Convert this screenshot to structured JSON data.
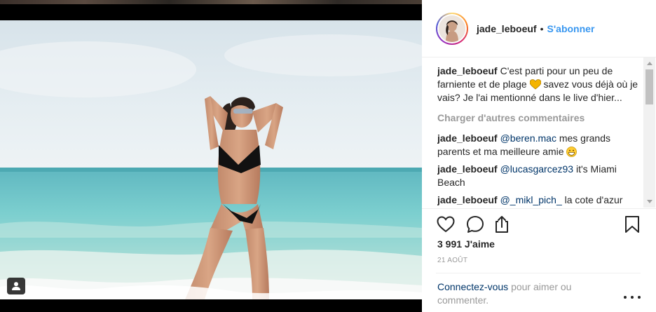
{
  "post": {
    "username": "jade_leboeuf",
    "separator": "•",
    "follow_label": "S'abonner",
    "caption_text": "C'est parti pour un peu de farniente et de plage",
    "caption_text_2": "savez vous déjà où je vais? Je l'ai mentionné dans le live d'hier...",
    "load_more_label": "Charger d'autres commentaires",
    "comments": [
      {
        "user": "jade_leboeuf",
        "mention": "@beren.mac",
        "text": "mes grands parents et ma meilleure amie"
      },
      {
        "user": "jade_leboeuf",
        "mention": "@lucasgarcez93",
        "text": "it's Miami Beach"
      },
      {
        "user": "jade_leboeuf",
        "mention": "@_mikl_pich_",
        "text": "la cote d'azur"
      }
    ],
    "likes": "3 991 J'aime",
    "date": "21 AOÛT",
    "login_link": "Connectez-vous",
    "login_text": "pour aimer ou commenter."
  },
  "icons": {
    "like": "heart-icon",
    "comment": "comment-bubble-icon",
    "share": "share-icon",
    "save": "bookmark-icon",
    "tag": "user-tag-icon",
    "more": "more-options-icon"
  },
  "colors": {
    "link_blue": "#3897f0",
    "mention_blue": "#003569",
    "muted_text": "#999999",
    "heart_emoji": "#f4b400"
  }
}
